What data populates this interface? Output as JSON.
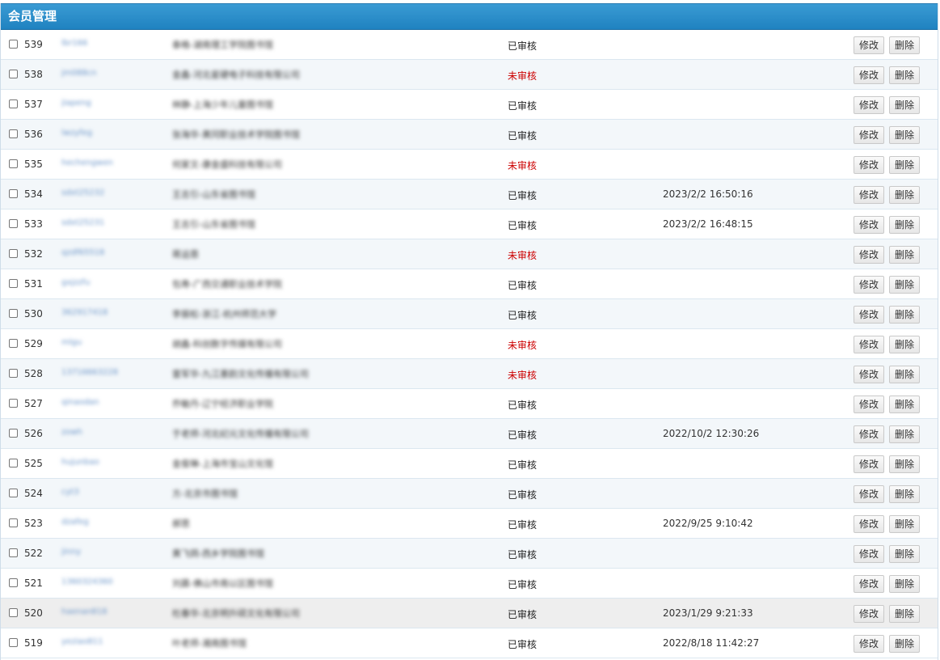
{
  "header": {
    "title": "会员管理"
  },
  "labels": {
    "edit": "修改",
    "delete": "删除"
  },
  "colors": {
    "header": "#2a8ac8",
    "pending": "#cc0000",
    "link": "#6a94c8"
  },
  "rows": [
    {
      "id": "539",
      "username": "lbr166",
      "org": "泰格-湖南理工学院图书馆",
      "status": "已审核",
      "pending": false,
      "date": ""
    },
    {
      "id": "538",
      "username": "jm088cn",
      "org": "金鑫-河北星硬电子科技有限公司",
      "status": "未审核",
      "pending": true,
      "date": ""
    },
    {
      "id": "537",
      "username": "jiapeng",
      "org": "林静-上海少年儿童图书馆",
      "status": "已审核",
      "pending": false,
      "date": ""
    },
    {
      "id": "536",
      "username": "lwzyfeg",
      "org": "张海华-黄冈职业技术学院图书馆",
      "status": "已审核",
      "pending": false,
      "date": ""
    },
    {
      "id": "535",
      "username": "hechengwen",
      "org": "何家文-康金盛科技有限公司",
      "status": "未审核",
      "pending": true,
      "date": ""
    },
    {
      "id": "534",
      "username": "sdxt25232",
      "org": "王志引-山东省图书馆",
      "status": "已审核",
      "pending": false,
      "date": "2023/2/2 16:50:16"
    },
    {
      "id": "533",
      "username": "sdxt25231",
      "org": "王志引-山东省图书馆",
      "status": "已审核",
      "pending": false,
      "date": "2023/2/2 16:48:15"
    },
    {
      "id": "532",
      "username": "qzdf65518",
      "org": "蒋运恩",
      "status": "未审核",
      "pending": true,
      "date": ""
    },
    {
      "id": "531",
      "username": "gxjzzfu",
      "org": "包寿-广西交通职业技术学院",
      "status": "已审核",
      "pending": false,
      "date": ""
    },
    {
      "id": "530",
      "username": "362917418",
      "org": "李振松-浙江-杭州师范大学",
      "status": "已审核",
      "pending": false,
      "date": ""
    },
    {
      "id": "529",
      "username": "mlgu",
      "org": "胡鑫-科创数字传媒有限公司",
      "status": "未审核",
      "pending": true,
      "date": ""
    },
    {
      "id": "528",
      "username": "13716663228",
      "org": "雷军华-九江墨韵文化传播有限公司",
      "status": "未审核",
      "pending": true,
      "date": ""
    },
    {
      "id": "527",
      "username": "qinaodan",
      "org": "乔敏丹-辽宁经济职业学院",
      "status": "已审核",
      "pending": false,
      "date": ""
    },
    {
      "id": "526",
      "username": "zowh",
      "org": "于老师-河北纪元文化传播有限公司",
      "status": "已审核",
      "pending": false,
      "date": "2022/10/2 12:30:26"
    },
    {
      "id": "525",
      "username": "hujunbao",
      "org": "金俊琳-上海市宝山文化馆",
      "status": "已审核",
      "pending": false,
      "date": ""
    },
    {
      "id": "524",
      "username": "cyt3",
      "org": "方-北京市图书馆",
      "status": "已审核",
      "pending": false,
      "date": ""
    },
    {
      "id": "523",
      "username": "dzafeg",
      "org": "郝思",
      "status": "已审核",
      "pending": false,
      "date": "2022/9/25 9:10:42"
    },
    {
      "id": "522",
      "username": "jinny",
      "org": "黄飞鸽-西乡学院图书馆",
      "status": "已审核",
      "pending": false,
      "date": ""
    },
    {
      "id": "521",
      "username": "1360324360",
      "org": "刘晨-佛山市南以区图书馆",
      "status": "已审核",
      "pending": false,
      "date": ""
    },
    {
      "id": "520",
      "username": "haenan818",
      "org": "杜春华-北京明升硕文化有限公司",
      "status": "已审核",
      "pending": false,
      "date": "2023/1/29 9:21:33"
    },
    {
      "id": "519",
      "username": "yeziao811",
      "org": "叶老师-湘南图书馆",
      "status": "已审核",
      "pending": false,
      "date": "2022/8/18 11:42:27"
    }
  ]
}
